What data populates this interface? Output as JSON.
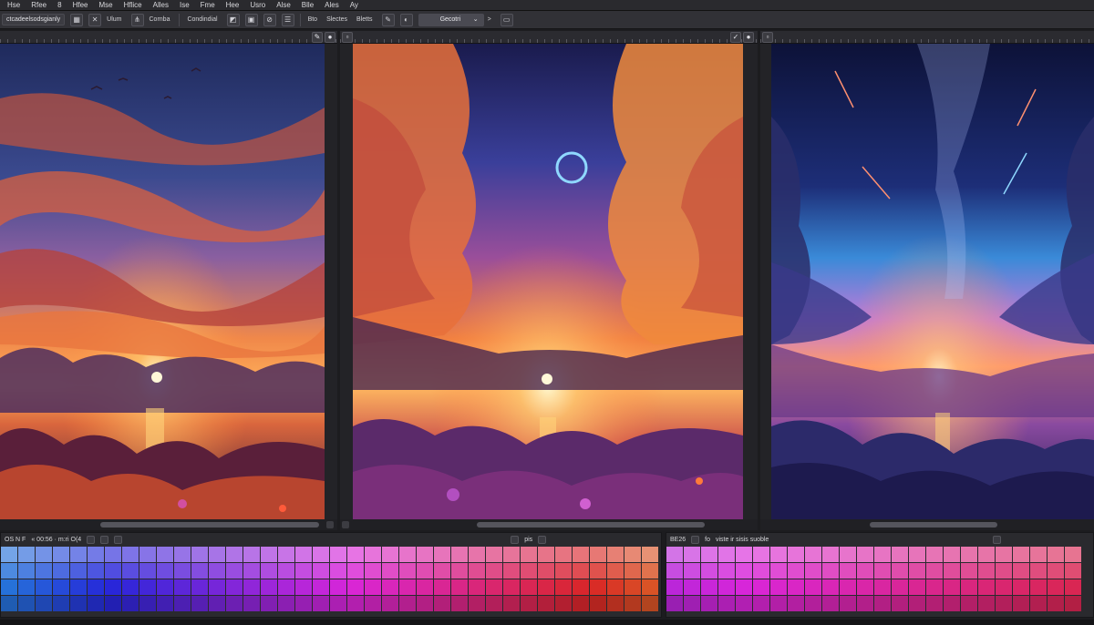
{
  "menubar": {
    "items": [
      "Hse",
      "Rfee",
      "8",
      "Hfee",
      "Mse",
      "Hflice",
      "Alles",
      "Ise",
      "Fme",
      "Hee",
      "Usro",
      "Alse",
      "Blle",
      "Ales",
      "Ay"
    ]
  },
  "toolbar": {
    "document_field": "ctcadeelsodsgianly",
    "view_label": "Ulum",
    "canvas_label": "Cornba",
    "mode_label": "Condindial",
    "format_label": "Bto",
    "slides_label": "Slectes",
    "blend_label": "Bletts",
    "selector_label": "Gecotri"
  },
  "icons": {
    "grid": "grid-icon",
    "close": "close-icon",
    "chart": "chart-icon",
    "layers": "layers-icon",
    "align": "align-icon",
    "pen": "pen-icon",
    "brush": "brush-icon",
    "lock": "lock-icon",
    "next": "chevron-right-icon",
    "panel": "panel-icon"
  },
  "swatches_left": {
    "header": "OS N F",
    "subheader": "« 00:56 · m:ri O(4",
    "search_placeholder": "pis"
  },
  "swatches_right": {
    "header": "BE26",
    "icon_label": "fo",
    "subheader": "viste ir sisis suoble"
  },
  "colors": {
    "app_bg": "#1c1c1f",
    "toolbar_bg": "#313136",
    "panel_bg": "#2a2a2e"
  }
}
